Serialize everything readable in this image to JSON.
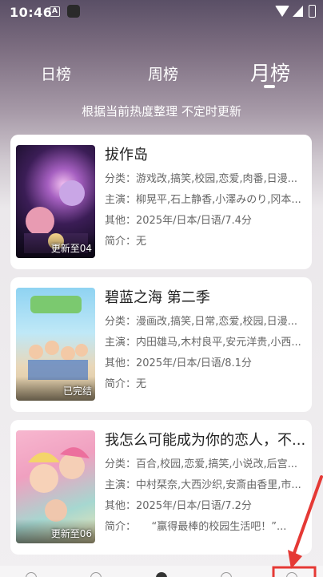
{
  "status": {
    "time": "10:46",
    "icon_a": "A"
  },
  "tabs": [
    {
      "label": "日榜",
      "active": false
    },
    {
      "label": "周榜",
      "active": false
    },
    {
      "label": "月榜",
      "active": true
    }
  ],
  "subtitle": "根据当前热度整理 不定时更新",
  "cards": [
    {
      "title": "拔作岛",
      "badge": "更新至04",
      "category": "分类：游戏改,搞笑,校园,恋爱,肉番,日漫...",
      "cast": "主演：柳晃平,石上静香,小澤みのり,冈本...",
      "other": "其他：2025年/日本/日语/7.4分",
      "intro": "简介：无"
    },
    {
      "title": "碧蓝之海 第二季",
      "badge": "已完结",
      "category": "分类：漫画改,搞笑,日常,恋爱,校园,日漫...",
      "cast": "主演：内田雄马,木村良平,安元洋贵,小西...",
      "other": "其他：2025年/日本/日语/8.1分",
      "intro": "简介：无"
    },
    {
      "title": "我怎么可能成为你的恋人，不...",
      "badge": "更新至06",
      "category": "分类：百合,校园,恋爱,搞笑,小说改,后宫...",
      "cast": "主演：中村栞奈,大西沙织,安斎由香里,市...",
      "other": "其他：2025年/日本/日语/7.2分",
      "intro": "简介：　　“赢得最棒的校园生活吧！”..."
    }
  ],
  "colors": {
    "arrow": "#e53935",
    "card_bg": "#ffffff"
  }
}
